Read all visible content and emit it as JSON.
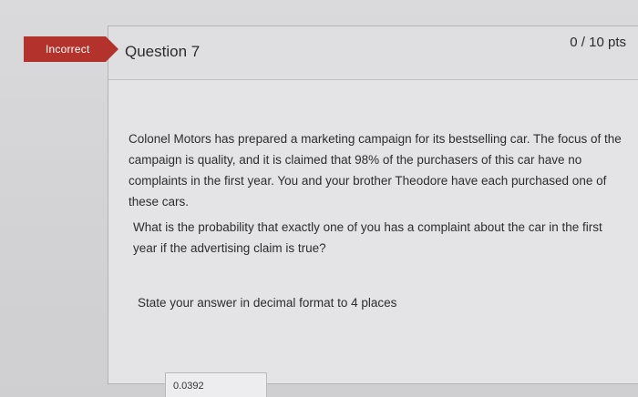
{
  "status_flag": {
    "label": "Incorrect",
    "color": "#b3332c"
  },
  "question": {
    "title": "Question 7",
    "points": "0 / 10 pts",
    "text_1": "Colonel Motors has prepared a marketing campaign for its bestselling car. The focus of the campaign is quality, and it is claimed that 98% of the purchasers of this car have no complaints in the first year. You and your brother Theodore have each purchased one of these cars.",
    "text_2": "What is the probability that exactly one of you has a complaint about the car in the first year if the advertising claim is true?",
    "text_3": "State your answer in decimal format to 4 places",
    "answer_value": "0.0392"
  }
}
